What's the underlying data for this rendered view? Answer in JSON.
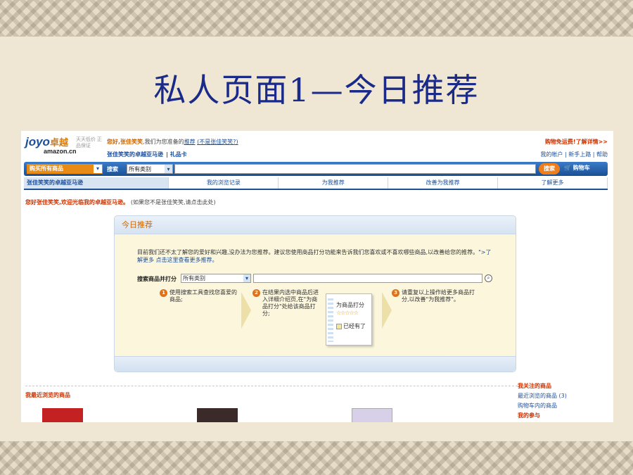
{
  "slide": {
    "title": "私人页面1—今日推荐"
  },
  "header": {
    "logo_joyo": "joyo",
    "logo_zhuoyue": "卓越",
    "logo_amazon": "amazon.cn",
    "slogan": "天天低价 正品保证",
    "greeting_prefix": "您好,",
    "user_name": "张佳笑笑",
    "greeting_text": ",我们为您准备的",
    "greeting_link": "推荐",
    "not_user_link": "(不是张佳笑笑?)",
    "personal_store": "张佳笑笑的卓越亚马逊",
    "gift_card": "礼品卡",
    "promo": "购物免运费!了解详情>>",
    "account_links": "我的帐户 | 新手上路 | 帮助"
  },
  "navbar": {
    "shop_all": "购买所有商品",
    "search_label": "搜索",
    "category": "所有类别",
    "search_button": "搜索",
    "cart": "购物车"
  },
  "tabs": [
    {
      "label": "张佳笑笑的卓越亚马逊"
    },
    {
      "label": "我的浏览记录"
    },
    {
      "label": "为我推荐"
    },
    {
      "label": "改善为我推荐"
    },
    {
      "label": "了解更多"
    }
  ],
  "welcome": {
    "text": "您好张佳笑笑,欢迎光临我的卓越亚马逊。",
    "note": "(如果您不是张佳笑笑,请点击此处)"
  },
  "today_box": {
    "title": "今日推荐",
    "intro": "目前我们还不太了解您的爱好和兴趣,没办法为您推荐。建议您使用商品打分功能来告诉我们您喜欢或不喜欢哪些商品,以改善给您的推荐。",
    "intro_link": "\">了解更多 点击这里查看更多推荐。",
    "rate_label": "搜索商品并打分",
    "rate_category": "所有类别",
    "steps": [
      {
        "num": "1",
        "text": "使用搜索工具查找您喜爱的商品;"
      },
      {
        "num": "2",
        "text": "在结果内选中商品后进入详细介绍页,在\"为商品打分\"处给该商品打分;"
      },
      {
        "num": "3",
        "text": "请重复以上操作给更多商品打分,以改善\"为我推荐\"。"
      }
    ],
    "popup_title": "为商品打分",
    "popup_stars": "☆☆☆☆☆",
    "popup_owned": "已经有了"
  },
  "recent": {
    "title": "我最近浏览的商品"
  },
  "right_col": {
    "followed": "我关注的商品",
    "recent_viewed": "最近浏览的商品 (3)",
    "cart_items": "购物车内的商品",
    "participation": "我的参与"
  }
}
